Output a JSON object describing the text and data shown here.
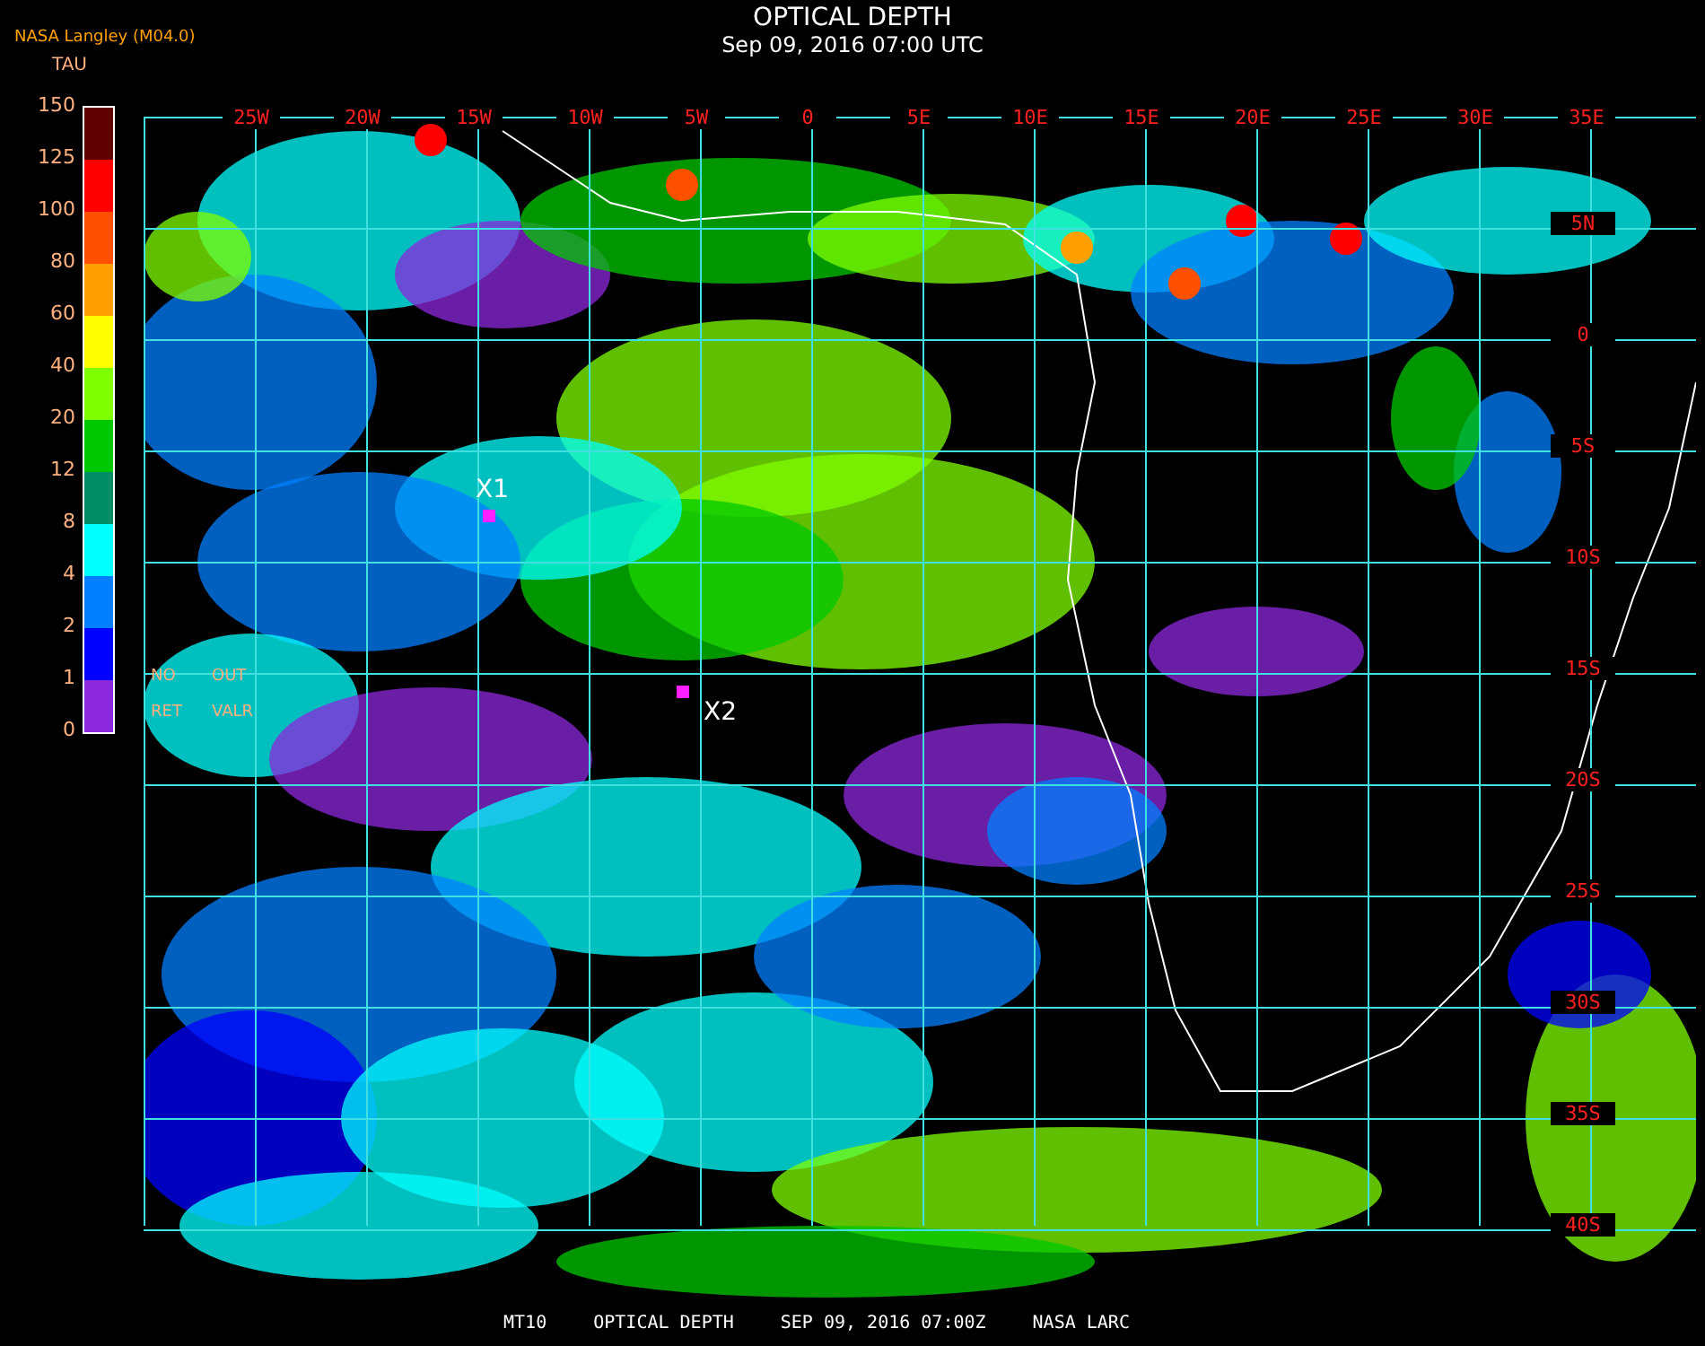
{
  "header": {
    "source": "NASA Langley (M04.0)",
    "title": "OPTICAL DEPTH",
    "timestamp": "Sep 09, 2016 07:00 UTC"
  },
  "legend": {
    "unit": "TAU",
    "ticks": [
      "150",
      "125",
      "100",
      "80",
      "60",
      "40",
      "20",
      "12",
      "8",
      "4",
      "2",
      "1",
      "0"
    ],
    "bands": [
      {
        "color": "#600000"
      },
      {
        "color": "#ff0000"
      },
      {
        "color": "#ff5000"
      },
      {
        "color": "#ffa000"
      },
      {
        "color": "#ffff00"
      },
      {
        "color": "#80ff00"
      },
      {
        "color": "#00c800"
      },
      {
        "color": "#008c64"
      },
      {
        "color": "#00ffff"
      },
      {
        "color": "#0080ff"
      },
      {
        "color": "#0000ff"
      },
      {
        "color": "#8c28dc"
      }
    ]
  },
  "map": {
    "longitudes": [
      "25W",
      "20W",
      "15W",
      "10W",
      "5W",
      "0",
      "5E",
      "10E",
      "15E",
      "20E",
      "25E",
      "30E",
      "35E"
    ],
    "latitudes": [
      "5N",
      "0",
      "5S",
      "10S",
      "15S",
      "20S",
      "25S",
      "30S",
      "35S",
      "40S"
    ],
    "markers": [
      {
        "label": "X1"
      },
      {
        "label": "X2"
      }
    ],
    "key_notes": [
      {
        "top": "NO",
        "bottom": "RET"
      },
      {
        "top": "OUT",
        "bottom": "VALR"
      }
    ]
  },
  "footer": [
    "MT10",
    "OPTICAL DEPTH",
    "SEP 09, 2016 07:00Z",
    "NASA LARC"
  ]
}
